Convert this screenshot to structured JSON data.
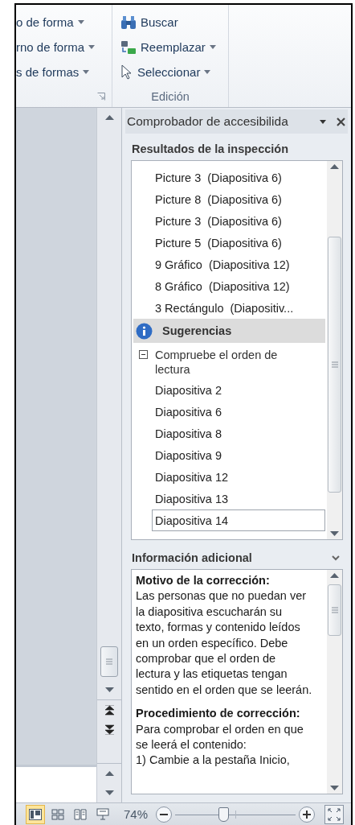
{
  "ribbon": {
    "groups": [
      {
        "launcher": true,
        "items": [
          {
            "label": "o de forma",
            "dropdown": true
          },
          {
            "label": "rno de forma",
            "dropdown": true
          },
          {
            "label": "s de formas",
            "dropdown": true
          }
        ]
      },
      {
        "label": "Edición",
        "launcher": false,
        "items": [
          {
            "label": "Buscar",
            "dropdown": false
          },
          {
            "label": "Reemplazar",
            "dropdown": true
          },
          {
            "label": "Seleccionar",
            "dropdown": true
          }
        ]
      }
    ]
  },
  "task_pane": {
    "title": "Comprobador de accesibilida",
    "results_heading": "Resultados de la inspección",
    "results": [
      {
        "kind": "item",
        "label": "Picture 3  (Diapositiva 6)",
        "selected": false
      },
      {
        "kind": "item",
        "label": "Picture 8  (Diapositiva 6)",
        "selected": false
      },
      {
        "kind": "item",
        "label": "Picture 3  (Diapositiva 6)",
        "selected": false
      },
      {
        "kind": "item",
        "label": "Picture 5  (Diapositiva 6)",
        "selected": false
      },
      {
        "kind": "item",
        "label": "9 Gráfico  (Diapositiva 12)",
        "selected": false
      },
      {
        "kind": "item",
        "label": "8 Gráfico  (Diapositiva 12)",
        "selected": false
      },
      {
        "kind": "item",
        "label": "3 Rectángulo  (Diapositiv...",
        "selected": false
      },
      {
        "kind": "section",
        "label": "Sugerencias"
      },
      {
        "kind": "group",
        "label": "Compruebe el orden de lectura",
        "expanded": true
      },
      {
        "kind": "item",
        "label": "Diapositiva 2",
        "selected": false
      },
      {
        "kind": "item",
        "label": "Diapositiva 6",
        "selected": false
      },
      {
        "kind": "item",
        "label": "Diapositiva 8",
        "selected": false
      },
      {
        "kind": "item",
        "label": "Diapositiva 9",
        "selected": false
      },
      {
        "kind": "item",
        "label": "Diapositiva 12",
        "selected": false
      },
      {
        "kind": "item",
        "label": "Diapositiva 13",
        "selected": false
      },
      {
        "kind": "item",
        "label": "Diapositiva 14",
        "selected": true
      }
    ],
    "info_heading": "Información adicional",
    "info": [
      {
        "kind": "heading",
        "text": "Motivo de la corrección:"
      },
      {
        "kind": "para",
        "text": "Las personas que no puedan ver la diapositiva escucharán su texto, formas y contenido leídos en un orden específico. Debe comprobar que el orden de lectura y las etiquetas tengan sentido en el orden que se leerán."
      },
      {
        "kind": "heading",
        "text": "Procedimiento de corrección:"
      },
      {
        "kind": "para",
        "text": "Para comprobar el orden en que se leerá el contenido:"
      },
      {
        "kind": "para",
        "text": "1) Cambie a la pestaña Inicio,"
      }
    ]
  },
  "status_bar": {
    "views": [
      {
        "selected": true
      },
      {
        "selected": false
      },
      {
        "selected": false
      },
      {
        "selected": false
      }
    ],
    "zoom": "74%",
    "zoom_slider": {
      "level": 0.4
    }
  }
}
